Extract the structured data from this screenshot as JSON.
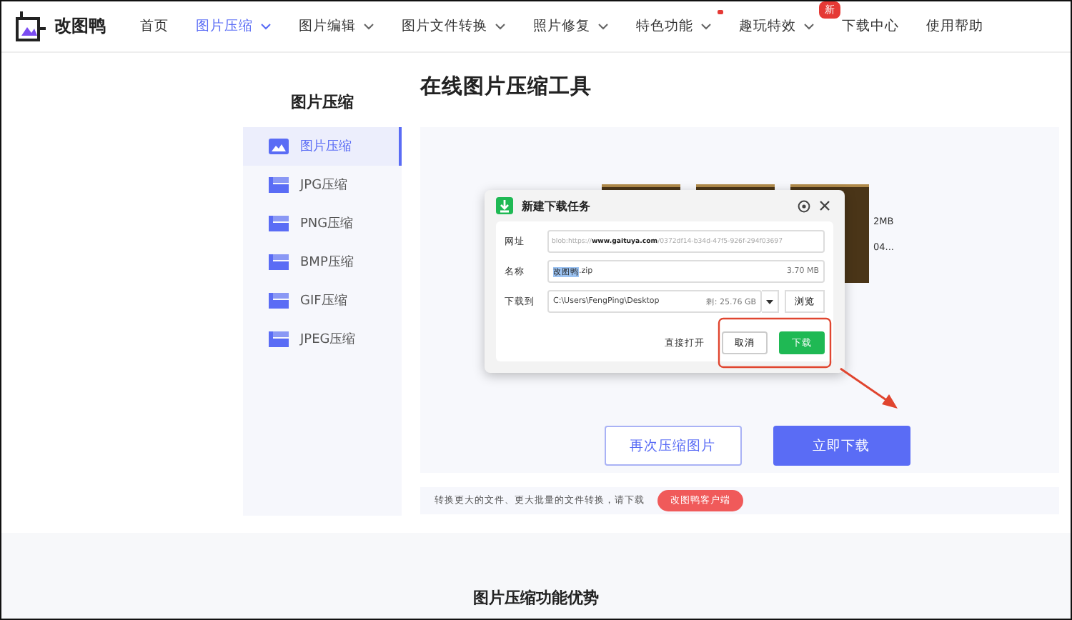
{
  "header": {
    "logo": "改图鸭",
    "nav": [
      {
        "label": "首页",
        "selected": false,
        "dropdown": false
      },
      {
        "label": "图片压缩",
        "selected": true,
        "dropdown": true
      },
      {
        "label": "图片编辑",
        "selected": false,
        "dropdown": true
      },
      {
        "label": "图片文件转换",
        "selected": false,
        "dropdown": true
      },
      {
        "label": "照片修复",
        "selected": false,
        "dropdown": true
      },
      {
        "label": "特色功能",
        "selected": false,
        "dropdown": true,
        "dot": true
      },
      {
        "label": "趣玩特效",
        "selected": false,
        "dropdown": true,
        "badge": "新"
      },
      {
        "label": "下载中心",
        "selected": false,
        "dropdown": false
      },
      {
        "label": "使用帮助",
        "selected": false,
        "dropdown": false
      }
    ]
  },
  "sidebar": {
    "title": "图片压缩",
    "items": [
      {
        "label": "图片压缩",
        "selected": true,
        "kind": "photo"
      },
      {
        "label": "JPG压缩",
        "selected": false,
        "kind": "file"
      },
      {
        "label": "PNG压缩",
        "selected": false,
        "kind": "file"
      },
      {
        "label": "BMP压缩",
        "selected": false,
        "kind": "file"
      },
      {
        "label": "GIF压缩",
        "selected": false,
        "kind": "file"
      },
      {
        "label": "JPEG压缩",
        "selected": false,
        "kind": "file"
      }
    ]
  },
  "main": {
    "title": "在线图片压缩工具",
    "thumbnails": [
      {
        "kind": "photo"
      },
      {
        "kind": "photo"
      },
      {
        "kind": "photo",
        "size": "2MB",
        "name": "04..."
      }
    ],
    "buttons": [
      {
        "label": "再次压缩图片",
        "kind": "outline"
      },
      {
        "label": "立即下载",
        "kind": "primary"
      }
    ],
    "notice": {
      "text": "转换更大的文件、更大批量的文件转换，请下载",
      "pill": "改图鸭客户端"
    }
  },
  "dialog": {
    "title": "新建下载任务",
    "url_label": "网址",
    "url": "blob:https://**www.gaituya.com**/0372df14-b34d-47f5-926f-294f03697",
    "name_label": "名称",
    "name_selected": "改图鸭",
    "name_rest": ".zip",
    "size": "3.70 MB",
    "path_label": "下载到",
    "path": "C:\\Users\\FengPing\\Desktop",
    "free": "剩: 25.76 GB",
    "browse": "浏览",
    "open_link": "直接打开",
    "cancel": "取消",
    "download": "下载"
  },
  "section": {
    "title": "图片压缩功能优势"
  }
}
